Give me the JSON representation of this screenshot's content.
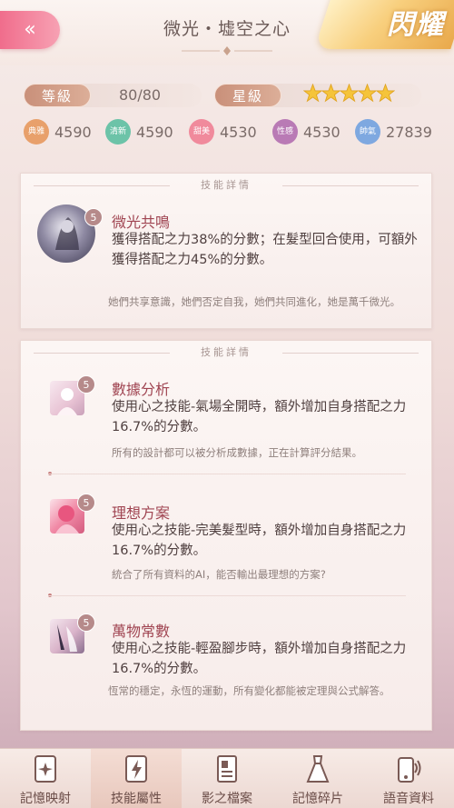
{
  "header": {
    "title": "微光・墟空之心",
    "shine_label": "閃耀"
  },
  "stats": {
    "level_label": "等級",
    "level_value": "80/80",
    "star_label": "星級",
    "stars": 5,
    "attributes": [
      {
        "name": "典雅",
        "value": "4590",
        "color": "#e8a06b"
      },
      {
        "name": "清新",
        "value": "4590",
        "color": "#6cc3a8"
      },
      {
        "name": "甜美",
        "value": "4530",
        "color": "#f08a9c"
      },
      {
        "name": "性感",
        "value": "4530",
        "color": "#b97ab5"
      },
      {
        "name": "帥氣",
        "value": "27839",
        "color": "#7ea8e0"
      }
    ]
  },
  "main_skill": {
    "section_title": "技能詳情",
    "level": "5",
    "name": "微光共鳴",
    "desc": "獲得搭配之力38%的分數；在髮型回合使用，可額外獲得搭配之力45%的分數。",
    "flavor": "她們共享意識，她們否定自我，她們共同進化，她是萬千微光。"
  },
  "sub_skills": {
    "section_title": "技能詳情",
    "items": [
      {
        "level": "5",
        "name": "數據分析",
        "desc": "使用心之技能-氣場全開時，額外增加自身搭配之力16.7%的分數。",
        "flavor": "所有的設計都可以被分析成數據，正在計算評分結果。"
      },
      {
        "level": "5",
        "name": "理想方案",
        "desc": "使用心之技能-完美髮型時，額外增加自身搭配之力16.7%的分數。",
        "flavor": "統合了所有資料的AI，能否輸出最理想的方案?"
      },
      {
        "level": "5",
        "name": "萬物常數",
        "desc": "使用心之技能-輕盈腳步時，額外增加自身搭配之力16.7%的分數。",
        "flavor": "恆常的穩定，永恆的運動，所有變化都能被定理與公式解答。"
      }
    ]
  },
  "nav": {
    "items": [
      {
        "label": "記憶映射",
        "icon": "memory-card-icon"
      },
      {
        "label": "技能屬性",
        "icon": "lightning-card-icon",
        "active": true
      },
      {
        "label": "影之檔案",
        "icon": "document-icon"
      },
      {
        "label": "記憶碎片",
        "icon": "dress-icon"
      },
      {
        "label": "語音資料",
        "icon": "phone-speaker-icon"
      }
    ]
  }
}
